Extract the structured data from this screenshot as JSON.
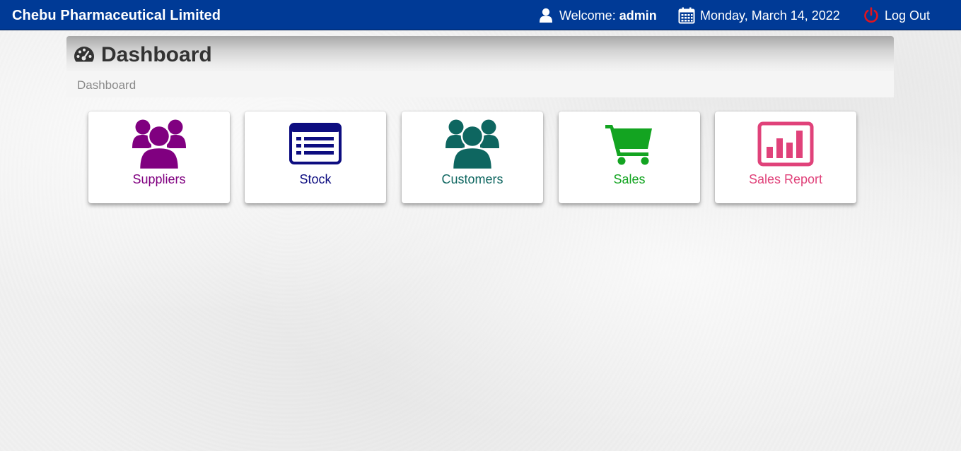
{
  "header": {
    "brand": "Chebu Pharmaceutical Limited",
    "welcome_label": "Welcome:",
    "username": "admin",
    "date": "Monday, March 14, 2022",
    "logout_label": "Log Out"
  },
  "page": {
    "title": "Dashboard",
    "breadcrumb": "Dashboard"
  },
  "tiles": [
    {
      "label": "Suppliers",
      "icon": "users-icon",
      "color": "#800080"
    },
    {
      "label": "Stock",
      "icon": "list-alt-icon",
      "color": "#0d0d80"
    },
    {
      "label": "Customers",
      "icon": "users-icon",
      "color": "#0e6660"
    },
    {
      "label": "Sales",
      "icon": "shopping-cart-icon",
      "color": "#13a421"
    },
    {
      "label": "Sales Report",
      "icon": "bar-chart-icon",
      "color": "#e0427a"
    }
  ],
  "colors": {
    "navbar": "#003a96",
    "logout_icon": "#e0141e"
  }
}
